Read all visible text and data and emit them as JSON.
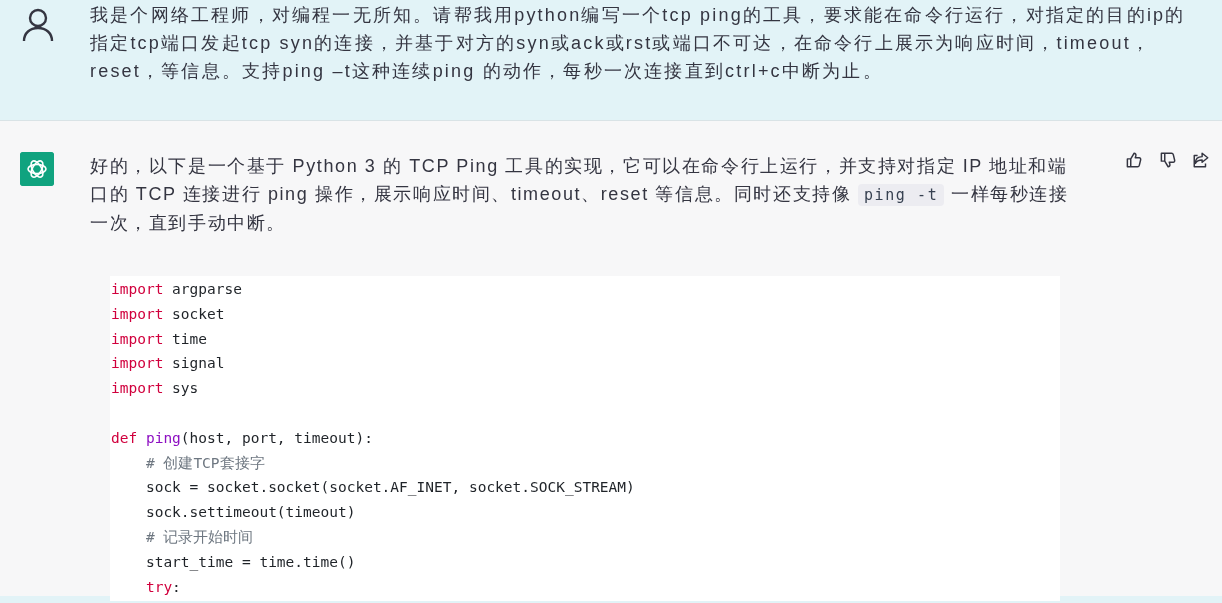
{
  "user_message": {
    "text": "我是个网络工程师，对编程一无所知。请帮我用python编写一个tcp ping的工具，要求能在命令行运行，对指定的目的ip的指定tcp端口发起tcp syn的连接，并基于对方的syn或ack或rst或端口不可达，在命令行上展示为响应时间，timeout，reset，等信息。支持ping –t这种连续ping 的动作，每秒一次连接直到ctrl+c中断为止。"
  },
  "assistant_message": {
    "parts": [
      {
        "kind": "text",
        "text": "好的，以下是一个基于 Python 3 的 TCP Ping 工具的实现，它可以在命令行上运行，并支持对指定 IP 地址和端口的 TCP 连接进行 ping 操作，展示响应时间、timeout、reset 等信息。同时还支持像 "
      },
      {
        "kind": "code",
        "text": "ping -t"
      },
      {
        "kind": "text",
        "text": " 一样每秒连接一次，直到手动中断。"
      }
    ],
    "code_lines": [
      {
        "tokens": [
          {
            "kind": "keyword",
            "text": "import"
          },
          {
            "kind": "plain",
            "text": " argparse"
          }
        ]
      },
      {
        "tokens": [
          {
            "kind": "keyword",
            "text": "import"
          },
          {
            "kind": "plain",
            "text": " socket"
          }
        ]
      },
      {
        "tokens": [
          {
            "kind": "keyword",
            "text": "import"
          },
          {
            "kind": "plain",
            "text": " time"
          }
        ]
      },
      {
        "tokens": [
          {
            "kind": "keyword",
            "text": "import"
          },
          {
            "kind": "plain",
            "text": " signal"
          }
        ]
      },
      {
        "tokens": [
          {
            "kind": "keyword",
            "text": "import"
          },
          {
            "kind": "plain",
            "text": " sys"
          }
        ]
      },
      {
        "kind": "blank"
      },
      {
        "tokens": [
          {
            "kind": "keyword",
            "text": "def "
          },
          {
            "kind": "function",
            "text": "ping"
          },
          {
            "kind": "plain",
            "text": "(host, port, timeout):"
          }
        ]
      },
      {
        "tokens": [
          {
            "kind": "comment",
            "text": "    # 创建TCP套接字"
          }
        ]
      },
      {
        "tokens": [
          {
            "kind": "plain",
            "text": "    sock = socket.socket(socket.AF_INET, socket.SOCK_STREAM)"
          }
        ]
      },
      {
        "tokens": [
          {
            "kind": "plain",
            "text": "    sock.settimeout(timeout)"
          }
        ]
      },
      {
        "tokens": [
          {
            "kind": "comment",
            "text": "    # 记录开始时间"
          }
        ]
      },
      {
        "tokens": [
          {
            "kind": "plain",
            "text": "    start_time = time.time()"
          }
        ]
      },
      {
        "tokens": [
          {
            "kind": "keyword",
            "text": "    try"
          },
          {
            "kind": "plain",
            "text": ":"
          }
        ]
      }
    ]
  }
}
